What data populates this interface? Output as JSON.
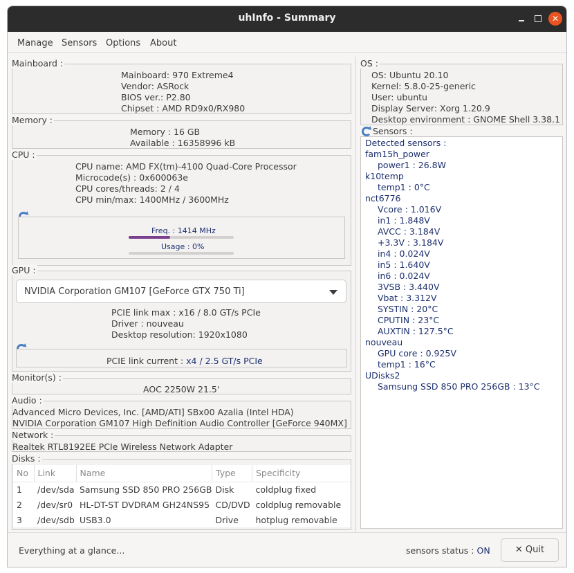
{
  "window": {
    "title": "uhInfo - Summary"
  },
  "menu": {
    "manage": "Manage",
    "sensors": "Sensors",
    "options": "Options",
    "about": "About"
  },
  "mainboard": {
    "title": "Mainboard :",
    "lines": [
      "Mainboard: 970 Extreme4",
      "Vendor: ASRock",
      "BIOS ver.: P2.80",
      "Chipset : AMD RD9x0/RX980"
    ]
  },
  "memory": {
    "title": "Memory :",
    "lines": [
      "Memory : 16 GB",
      "Available : 16358996 kB"
    ]
  },
  "cpu": {
    "title": "CPU :",
    "lines": [
      "CPU name: AMD FX(tm)-4100 Quad-Core Processor",
      "Microcode(s) : 0x600063e",
      "CPU cores/threads: 2 / 4",
      "CPU min/max: 1400MHz / 3600MHz"
    ],
    "freq_label": "Freq. : 1414 MHz",
    "freq_fraction": 0.393,
    "usage_label": "Usage : 0%",
    "usage_fraction": 0.0
  },
  "gpu": {
    "title": "GPU :",
    "selected": "NVIDIA Corporation GM107 [GeForce GTX 750 Ti]",
    "lines": [
      "PCIE link max : x16 / 8.0 GT/s PCIe",
      "Driver : nouveau",
      "Desktop resolution: 1920x1080"
    ],
    "link_label": "PCIE link current : ",
    "link_value": "x4 / 2.5 GT/s PCIe"
  },
  "monitor": {
    "title": "Monitor(s) :",
    "value": "AOC 2250W  21.5'"
  },
  "audio": {
    "title": "Audio :",
    "lines": [
      "Advanced Micro Devices, Inc. [AMD/ATI] SBx00 Azalia (Intel HDA)",
      "NVIDIA Corporation GM107 High Definition Audio Controller [GeForce 940MX]"
    ]
  },
  "network": {
    "title": "Network :",
    "value": "Realtek RTL8192EE PCIe Wireless Network Adapter"
  },
  "disks": {
    "title": "Disks :",
    "headers": [
      "No",
      "Link",
      "Name",
      "Type",
      "Specificity"
    ],
    "rows": [
      [
        "1",
        "/dev/sda",
        "Samsung SSD 850 PRO 256GB",
        "Disk",
        "coldplug  fixed"
      ],
      [
        "2",
        "/dev/sr0",
        "HL-DT-ST DVDRAM GH24NS95",
        "CD/DVD",
        "coldplug  removable"
      ],
      [
        "3",
        "/dev/sdb",
        "USB3.0",
        "Drive",
        "hotplug  removable"
      ]
    ]
  },
  "os": {
    "title": "OS :",
    "lines": [
      "OS: Ubuntu 20.10",
      "Kernel: 5.8.0-25-generic",
      "User: ubuntu",
      "Display Server: Xorg 1.20.9",
      "Desktop environment : GNOME Shell 3.38.1"
    ]
  },
  "sensors": {
    "title": "Sensors :",
    "header": "Detected sensors :",
    "groups": [
      {
        "name": "fam15h_power",
        "items": [
          "power1 : 26.8W"
        ]
      },
      {
        "name": "k10temp",
        "items": [
          "temp1 :  0°C"
        ]
      },
      {
        "name": "nct6776",
        "items": [
          "Vcore : 1.016V",
          "in1 : 1.848V",
          "AVCC : 3.184V",
          "+3.3V : 3.184V",
          "in4 : 0.024V",
          "in5 : 1.640V",
          "in6 : 0.024V",
          "3VSB : 3.440V",
          "Vbat : 3.312V",
          "SYSTIN : 20°C",
          "CPUTIN : 23°C",
          "AUXTIN : 127.5°C"
        ]
      },
      {
        "name": "nouveau",
        "items": [
          "GPU core : 0.925V",
          "temp1 : 16°C"
        ]
      },
      {
        "name": "UDisks2",
        "items": [
          "Samsung SSD 850 PRO 256GB : 13°C"
        ]
      }
    ]
  },
  "status": {
    "message": "Everything at a glance...",
    "sensors_label": "sensors status : ",
    "sensors_value": "ON",
    "quit_label": "Quit",
    "quit_icon": "close-icon"
  },
  "colors": {
    "accent": "#7a3f8e",
    "close": "#e95420",
    "value_blue": "#1c2f6e"
  }
}
